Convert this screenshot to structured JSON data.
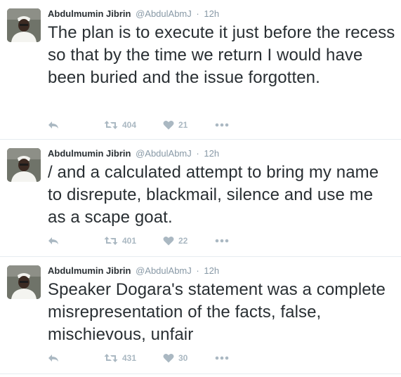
{
  "colors": {
    "secondary_text": "#8899a6",
    "action_icon": "#aab8c2",
    "divider": "#e6ecf0"
  },
  "tweets": [
    {
      "author_name": "Abdulmumin Jibrin",
      "handle": "@AbdulAbmJ",
      "separator": "·",
      "time": "12h",
      "text": "The plan is to execute it just before the recess so that by the time we return I would have been buried and the issue forgotten.",
      "retweets": "404",
      "likes": "21",
      "icons": [
        "reply-icon",
        "retweet-icon",
        "heart-icon",
        "more-icon"
      ]
    },
    {
      "author_name": "Abdulmumin Jibrin",
      "handle": "@AbdulAbmJ",
      "separator": "·",
      "time": "12h",
      "text": "/ and a calculated attempt to bring my name to disrepute, blackmail, silence and use me as a scape goat.",
      "retweets": "401",
      "likes": "22",
      "icons": [
        "reply-icon",
        "retweet-icon",
        "heart-icon",
        "more-icon"
      ]
    },
    {
      "author_name": "Abdulmumin Jibrin",
      "handle": "@AbdulAbmJ",
      "separator": "·",
      "time": "12h",
      "text": "Speaker Dogara's statement was a complete misrepresentation of the facts, false, mischievous, unfair",
      "retweets": "431",
      "likes": "30",
      "icons": [
        "reply-icon",
        "retweet-icon",
        "heart-icon",
        "more-icon"
      ]
    }
  ]
}
